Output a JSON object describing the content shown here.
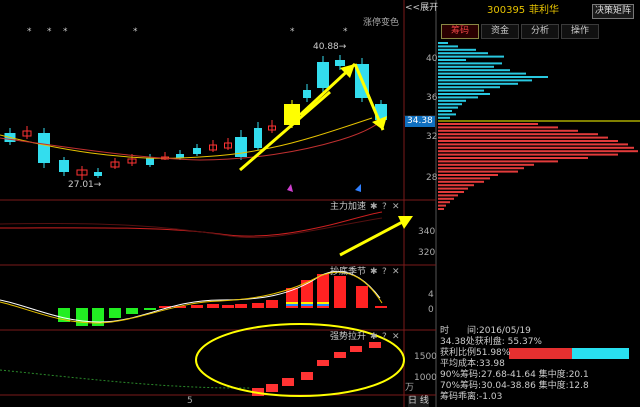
{
  "top": {
    "collapse_label": "<<展开",
    "stock_code": "300395",
    "stock_name": "菲利华",
    "decision_button": "决策矩阵"
  },
  "tabs": [
    "筹码",
    "资金",
    "分析",
    "操作"
  ],
  "main_panel": {
    "overlay_label": "涨停变色",
    "star_glyph": "*",
    "high_label": "40.88→",
    "low_label": "27.01→",
    "current_price_badge": "34.38"
  },
  "indicators": {
    "panel1_title": "主力加速",
    "panel2_title": "抄底季节",
    "panel3_title": "强势拉升",
    "icon_gear": "✱",
    "icon_help": "?",
    "icon_close": "✕"
  },
  "axes": {
    "distribution_price_ticks": [
      "40",
      "36",
      "32",
      "28"
    ],
    "indicator1_ticks": [
      "340",
      "320"
    ],
    "indicator2_ticks": [
      "4",
      "0"
    ],
    "indicator3_ticks": [
      "1500",
      "1000"
    ],
    "volume_unit": "万",
    "x_tick": "5",
    "period_label": "日 线"
  },
  "chip_info": {
    "date_label": "时　　间:2016/05/19",
    "profit_line": "34.38处获利盘: 55.37%",
    "profit_ratio_label": "获利比例:",
    "profit_ratio_value": "51.98%",
    "avg_cost": "平均成本:33.98",
    "cost_90": "90%筹码:27.68-41.64 集中度:20.1",
    "cost_70": "70%筹码:30.04-38.86 集中度:12.8",
    "chip_factor": "筹码乖离:-1.03"
  },
  "colors": {
    "up": "#ff3333",
    "down": "#33ddee",
    "highlight": "#ffff00",
    "ma_yellow": "#e6c200",
    "ma_red": "#c03030",
    "distribution_gain": "#e23b3b",
    "distribution_loss": "#29c8e0"
  }
}
